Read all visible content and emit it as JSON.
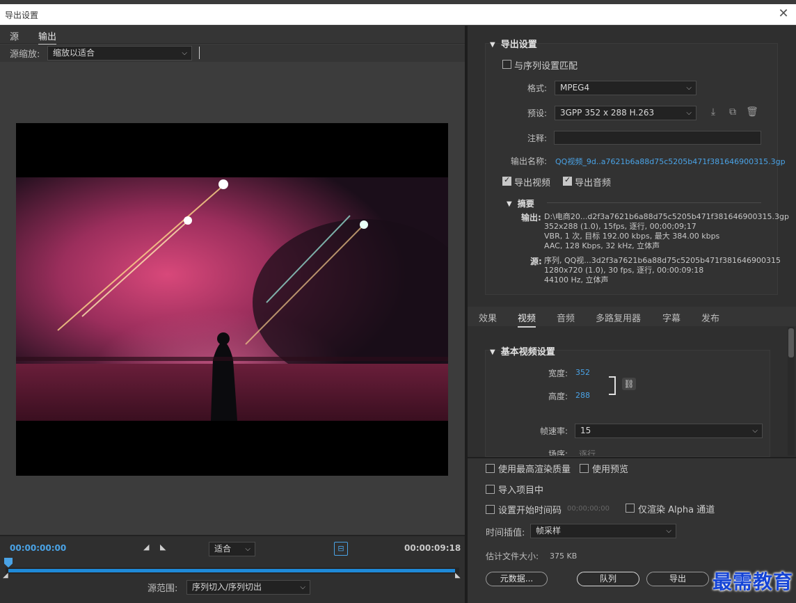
{
  "window": {
    "title": "导出设置",
    "close_glyph": "✕"
  },
  "left": {
    "tabs": [
      "源",
      "输出"
    ],
    "active_tab": "输出",
    "zoom_label": "源缩放:",
    "zoom_value": "缩放以适合",
    "timecode_start": "00:00:00:00",
    "timecode_end": "00:00:09:18",
    "fit_value": "适合",
    "range_label": "源范围:",
    "range_value": "序列切入/序列切出"
  },
  "export": {
    "section_title": "导出设置",
    "match_sequence_label": "与序列设置匹配",
    "format_label": "格式:",
    "format_value": "MPEG4",
    "preset_label": "预设:",
    "preset_value": "3GPP 352 x 288 H.263",
    "comment_label": "注释:",
    "comment_value": "",
    "output_name_label": "输出名称:",
    "output_name_value": "QQ视频_9d..a7621b6a88d75c5205b471f381646900315.3gp",
    "export_video_label": "导出视频",
    "export_audio_label": "导出音频",
    "summary_title": "摘要",
    "output_key": "输出:",
    "output_lines": [
      "D:\\电商20...d2f3a7621b6a88d75c5205b471f381646900315.3gp",
      "352x288 (1.0), 15fps, 逐行, 00;00;09;17",
      "VBR, 1 次, 目标 192.00 kbps, 最大 384.00 kbps",
      "AAC, 128 Kbps, 32 kHz, 立体声"
    ],
    "source_key": "源:",
    "source_lines": [
      "序列, QQ视...3d2f3a7621b6a88d75c5205b471f381646900315",
      "1280x720 (1.0), 30 fps, 逐行, 00:00:09:18",
      "44100 Hz, 立体声"
    ]
  },
  "tabs": [
    "效果",
    "视频",
    "音频",
    "多路复用器",
    "字幕",
    "发布"
  ],
  "active_tab": "视频",
  "video": {
    "section_title": "基本视频设置",
    "width_label": "宽度:",
    "width_value": "352",
    "height_label": "高度:",
    "height_value": "288",
    "fps_label": "帧速率:",
    "fps_value": "15",
    "field_label": "场序:",
    "field_value": "逐行"
  },
  "bottom": {
    "max_render_label": "使用最高渲染质量",
    "use_preview_label": "使用预览",
    "import_project_label": "导入项目中",
    "set_timecode_label": "设置开始时间码",
    "timecode_value": "00;00;00;00",
    "alpha_only_label": "仅渲染 Alpha 通道",
    "interp_label": "时间插值:",
    "interp_value": "帧采样",
    "filesize_label": "估计文件大小:",
    "filesize_value": "375 KB",
    "metadata_button": "元数据...",
    "queue_button": "队列",
    "export_button": "导出"
  },
  "watermark": "最需教育"
}
